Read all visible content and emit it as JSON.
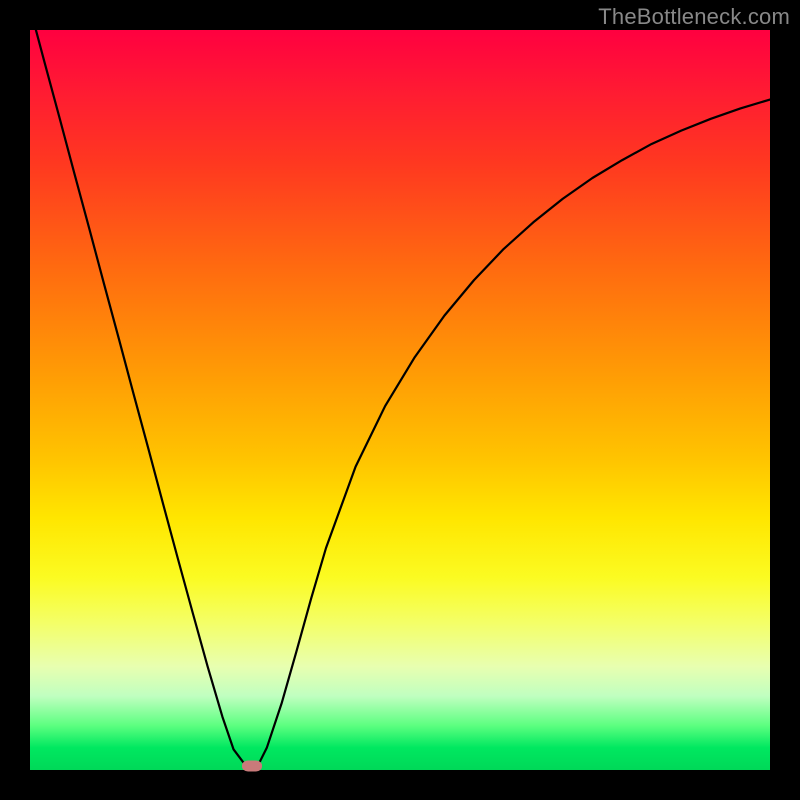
{
  "watermark": "TheBottleneck.com",
  "chart_data": {
    "type": "line",
    "title": "",
    "xlabel": "",
    "ylabel": "",
    "xlim": [
      0,
      1
    ],
    "ylim": [
      0,
      1
    ],
    "x": [
      0.0,
      0.02,
      0.04,
      0.06,
      0.08,
      0.1,
      0.12,
      0.14,
      0.16,
      0.18,
      0.2,
      0.22,
      0.24,
      0.26,
      0.275,
      0.29,
      0.3,
      0.31,
      0.32,
      0.34,
      0.36,
      0.38,
      0.4,
      0.44,
      0.48,
      0.52,
      0.56,
      0.6,
      0.64,
      0.68,
      0.72,
      0.76,
      0.8,
      0.84,
      0.88,
      0.92,
      0.96,
      1.0
    ],
    "values": [
      1.03,
      0.955,
      0.881,
      0.806,
      0.732,
      0.657,
      0.583,
      0.508,
      0.434,
      0.359,
      0.285,
      0.212,
      0.14,
      0.072,
      0.028,
      0.008,
      0.0,
      0.01,
      0.03,
      0.09,
      0.16,
      0.232,
      0.3,
      0.41,
      0.492,
      0.558,
      0.614,
      0.662,
      0.704,
      0.74,
      0.772,
      0.8,
      0.824,
      0.846,
      0.864,
      0.88,
      0.894,
      0.906
    ],
    "minimum_marker": {
      "x": 0.3,
      "y": 0.005
    },
    "background_gradient": {
      "top": "#ff0040",
      "mid": "#ffe600",
      "bottom": "#00d858"
    }
  }
}
